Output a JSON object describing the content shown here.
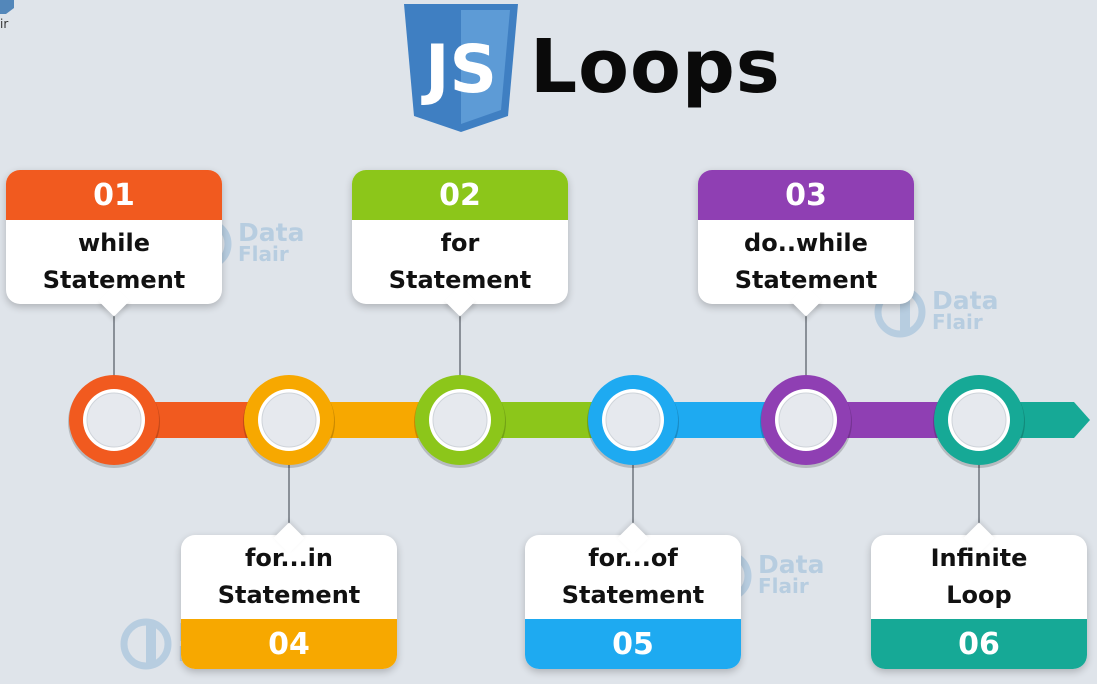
{
  "header": {
    "logo_text": "JS",
    "title": "Loops"
  },
  "watermark": {
    "line1": "Data",
    "line2": "Flair"
  },
  "steps": [
    {
      "number": "01",
      "lines": [
        "while",
        "Statement"
      ],
      "color": "#f15a1f",
      "position": "top"
    },
    {
      "number": "04",
      "lines": [
        "for...in",
        "Statement"
      ],
      "color": "#f7a800",
      "position": "bottom"
    },
    {
      "number": "02",
      "lines": [
        "for",
        "Statement"
      ],
      "color": "#8cc61a",
      "position": "top"
    },
    {
      "number": "05",
      "lines": [
        "for...of",
        "Statement"
      ],
      "color": "#1eaaf1",
      "position": "bottom"
    },
    {
      "number": "03",
      "lines": [
        "do..while",
        "Statement"
      ],
      "color": "#8f3fb3",
      "position": "top"
    },
    {
      "number": "06",
      "lines": [
        "Infinite",
        "Loop"
      ],
      "color": "#16a996",
      "position": "bottom"
    }
  ],
  "colors": {
    "background": "#dfe4ea",
    "js_blue_light": "#5b9bd5",
    "js_blue_dark": "#2f6fae"
  }
}
